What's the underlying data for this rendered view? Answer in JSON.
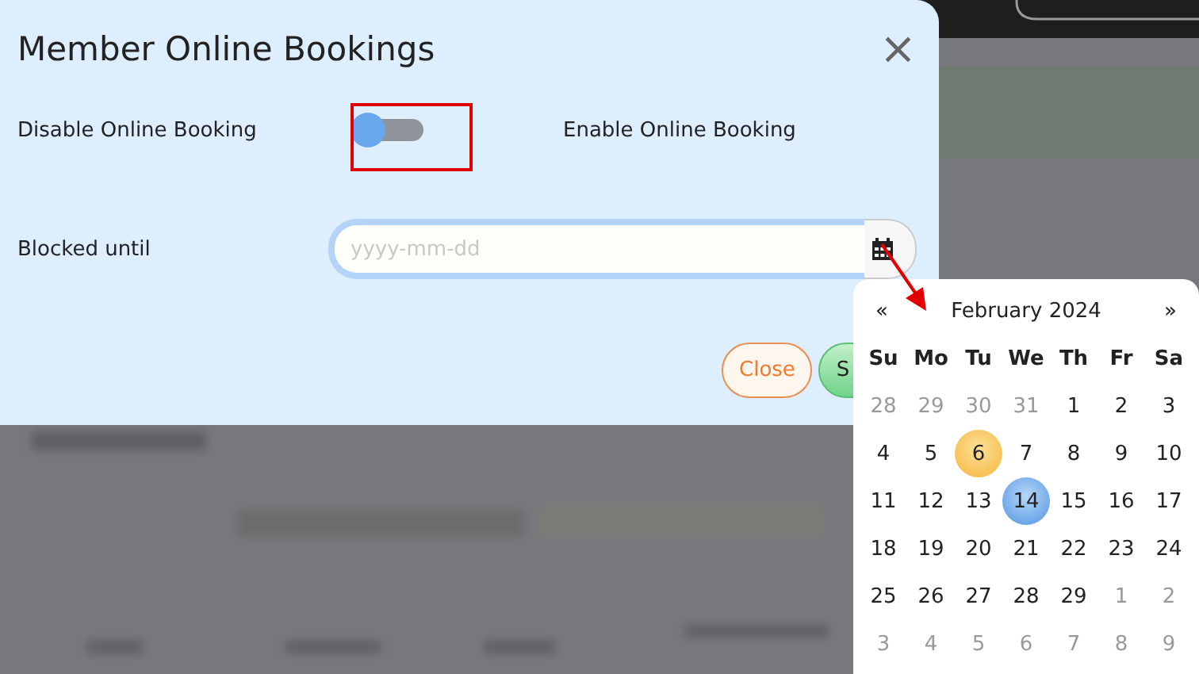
{
  "dialog": {
    "title": "Member Online Bookings",
    "close_icon": "×",
    "toggle_row": {
      "off_label": "Disable Online Booking",
      "on": false,
      "on_label": "Enable Online Booking"
    },
    "blocked_until": {
      "label": "Blocked until",
      "placeholder": "yyyy-mm-dd"
    },
    "buttons": [
      {
        "label": "Close",
        "kind": "secondary"
      },
      {
        "label": "S",
        "kind": "primary"
      }
    ]
  },
  "datepicker": {
    "prev": "«",
    "month": "February 2024",
    "next": "»",
    "weekdays": [
      "Su",
      "Mo",
      "Tu",
      "We",
      "Th",
      "Fr",
      "Sa"
    ],
    "weeks": [
      [
        {
          "day": "28",
          "other_month": true,
          "today": false,
          "selected": false
        },
        {
          "day": "29",
          "other_month": true,
          "today": false,
          "selected": false
        },
        {
          "day": "30",
          "other_month": true,
          "today": false,
          "selected": false
        },
        {
          "day": "31",
          "other_month": true,
          "today": false,
          "selected": false
        },
        {
          "day": "1",
          "other_month": false,
          "today": false,
          "selected": false
        },
        {
          "day": "2",
          "other_month": false,
          "today": false,
          "selected": false
        },
        {
          "day": "3",
          "other_month": false,
          "today": false,
          "selected": false
        }
      ],
      [
        {
          "day": "4",
          "other_month": false,
          "today": false,
          "selected": false
        },
        {
          "day": "5",
          "other_month": false,
          "today": false,
          "selected": false
        },
        {
          "day": "6",
          "other_month": false,
          "today": true,
          "selected": false
        },
        {
          "day": "7",
          "other_month": false,
          "today": false,
          "selected": false
        },
        {
          "day": "8",
          "other_month": false,
          "today": false,
          "selected": false
        },
        {
          "day": "9",
          "other_month": false,
          "today": false,
          "selected": false
        },
        {
          "day": "10",
          "other_month": false,
          "today": false,
          "selected": false
        }
      ],
      [
        {
          "day": "11",
          "other_month": false,
          "today": false,
          "selected": false
        },
        {
          "day": "12",
          "other_month": false,
          "today": false,
          "selected": false
        },
        {
          "day": "13",
          "other_month": false,
          "today": false,
          "selected": false
        },
        {
          "day": "14",
          "other_month": false,
          "today": false,
          "selected": true
        },
        {
          "day": "15",
          "other_month": false,
          "today": false,
          "selected": false
        },
        {
          "day": "16",
          "other_month": false,
          "today": false,
          "selected": false
        },
        {
          "day": "17",
          "other_month": false,
          "today": false,
          "selected": false
        }
      ],
      [
        {
          "day": "18",
          "other_month": false,
          "today": false,
          "selected": false
        },
        {
          "day": "19",
          "other_month": false,
          "today": false,
          "selected": false
        },
        {
          "day": "20",
          "other_month": false,
          "today": false,
          "selected": false
        },
        {
          "day": "21",
          "other_month": false,
          "today": false,
          "selected": false
        },
        {
          "day": "22",
          "other_month": false,
          "today": false,
          "selected": false
        },
        {
          "day": "23",
          "other_month": false,
          "today": false,
          "selected": false
        },
        {
          "day": "24",
          "other_month": false,
          "today": false,
          "selected": false
        }
      ],
      [
        {
          "day": "25",
          "other_month": false,
          "today": false,
          "selected": false
        },
        {
          "day": "26",
          "other_month": false,
          "today": false,
          "selected": false
        },
        {
          "day": "27",
          "other_month": false,
          "today": false,
          "selected": false
        },
        {
          "day": "28",
          "other_month": false,
          "today": false,
          "selected": false
        },
        {
          "day": "29",
          "other_month": false,
          "today": false,
          "selected": false
        },
        {
          "day": "1",
          "other_month": true,
          "today": false,
          "selected": false
        },
        {
          "day": "2",
          "other_month": true,
          "today": false,
          "selected": false
        }
      ],
      [
        {
          "day": "3",
          "other_month": true,
          "today": false,
          "selected": false
        },
        {
          "day": "4",
          "other_month": true,
          "today": false,
          "selected": false
        },
        {
          "day": "5",
          "other_month": true,
          "today": false,
          "selected": false
        },
        {
          "day": "6",
          "other_month": true,
          "today": false,
          "selected": false
        },
        {
          "day": "7",
          "other_month": true,
          "today": false,
          "selected": false
        },
        {
          "day": "8",
          "other_month": true,
          "today": false,
          "selected": false
        },
        {
          "day": "9",
          "other_month": true,
          "today": false,
          "selected": false
        }
      ]
    ]
  }
}
